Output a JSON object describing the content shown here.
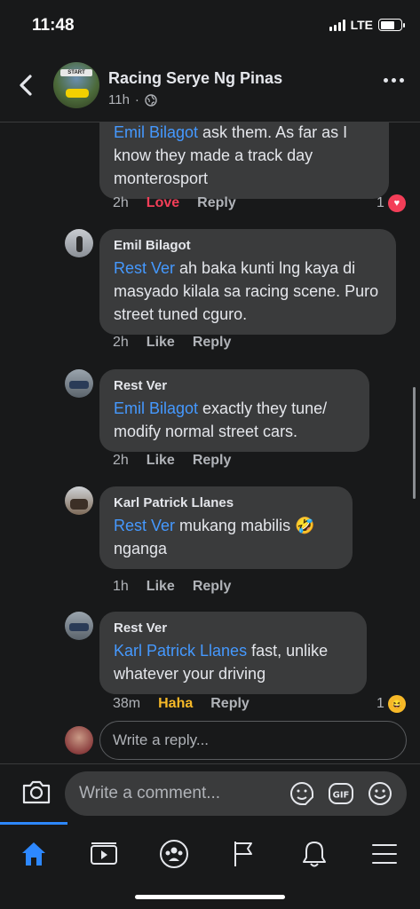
{
  "status": {
    "time": "11:48",
    "network": "LTE"
  },
  "header": {
    "page_name": "Racing Serye Ng Pinas",
    "post_age": "11h"
  },
  "comments": [
    {
      "mention": "Emil Bilagot",
      "text_line1": " ask them. As far as I",
      "text_rest": "know they made a track day monterosport",
      "time": "2h",
      "reaction_label": "Love",
      "reply": "Reply",
      "reaction_count": "1"
    },
    {
      "name": "Emil Bilagot",
      "mention": "Rest Ver",
      "text": " ah baka kunti lng kaya di masyado kilala sa racing scene. Puro street tuned cguro.",
      "time": "2h",
      "like": "Like",
      "reply": "Reply"
    },
    {
      "name": "Rest Ver",
      "mention": "Emil Bilagot",
      "text": " exactly they tune/ modify normal street cars.",
      "time": "2h",
      "like": "Like",
      "reply": "Reply"
    },
    {
      "name": "Karl Patrick Llanes",
      "mention": "Rest Ver",
      "text": " mukang mabilis 🤣 nganga",
      "time": "1h",
      "like": "Like",
      "reply": "Reply"
    },
    {
      "name": "Rest Ver",
      "mention": "Karl Patrick Llanes",
      "text": " fast, unlike whatever your driving",
      "time": "38m",
      "reaction_label": "Haha",
      "reply": "Reply",
      "reaction_count": "1"
    }
  ],
  "reply_input": {
    "placeholder": "Write a reply..."
  },
  "comment_input": {
    "placeholder": "Write a comment..."
  },
  "icons": {
    "back": "chevron-left-icon",
    "more": "more-horizontal-icon",
    "camera": "camera-icon",
    "sticker": "sticker-icon",
    "gif": "gif-icon",
    "emoji": "emoji-icon",
    "home": "home-icon",
    "watch": "video-icon",
    "groups": "groups-icon",
    "pages": "flag-icon",
    "notifications": "bell-icon",
    "menu": "menu-icon"
  },
  "colors": {
    "accent": "#2d88ff",
    "mention": "#4599ff",
    "love": "#f33e58",
    "haha": "#f7b928",
    "bubble": "#3a3b3c",
    "background": "#18191a"
  }
}
